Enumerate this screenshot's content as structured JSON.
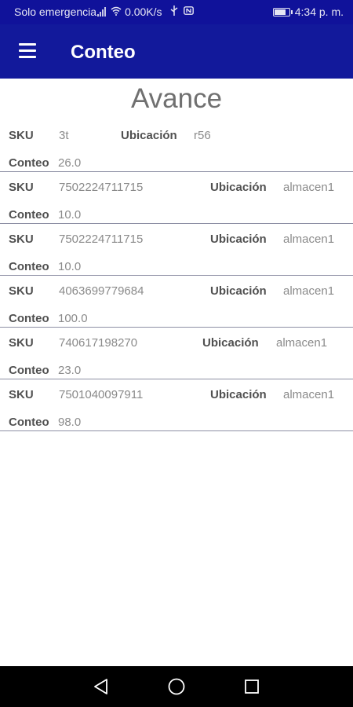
{
  "status_bar": {
    "carrier": "Solo emergencia",
    "speed": "0.00K/s",
    "time": "4:34 p. m."
  },
  "app_bar": {
    "title": "Conteo"
  },
  "page": {
    "title": "Avance"
  },
  "labels": {
    "sku": "SKU",
    "ubicacion": "Ubicación",
    "conteo": "Conteo"
  },
  "rows": [
    {
      "sku": "3t",
      "ubicacion": "r56",
      "conteo": "26.0"
    },
    {
      "sku": "7502224711715",
      "ubicacion": "almacen1",
      "conteo": "10.0"
    },
    {
      "sku": "7502224711715",
      "ubicacion": "almacen1",
      "conteo": "10.0"
    },
    {
      "sku": "4063699779684",
      "ubicacion": "almacen1",
      "conteo": "100.0"
    },
    {
      "sku": "740617198270",
      "ubicacion": "almacen1",
      "conteo": "23.0"
    },
    {
      "sku": "7501040097911",
      "ubicacion": "almacen1",
      "conteo": "98.0"
    }
  ],
  "colors": {
    "app_bar": "#12199b",
    "status_bar": "#10129a",
    "divider": "#8d8fa4"
  },
  "icons": [
    "signal-icon",
    "wifi-icon",
    "usb-icon",
    "nfc-icon",
    "battery-icon",
    "menu-icon",
    "back-icon",
    "home-icon",
    "recent-apps-icon"
  ]
}
